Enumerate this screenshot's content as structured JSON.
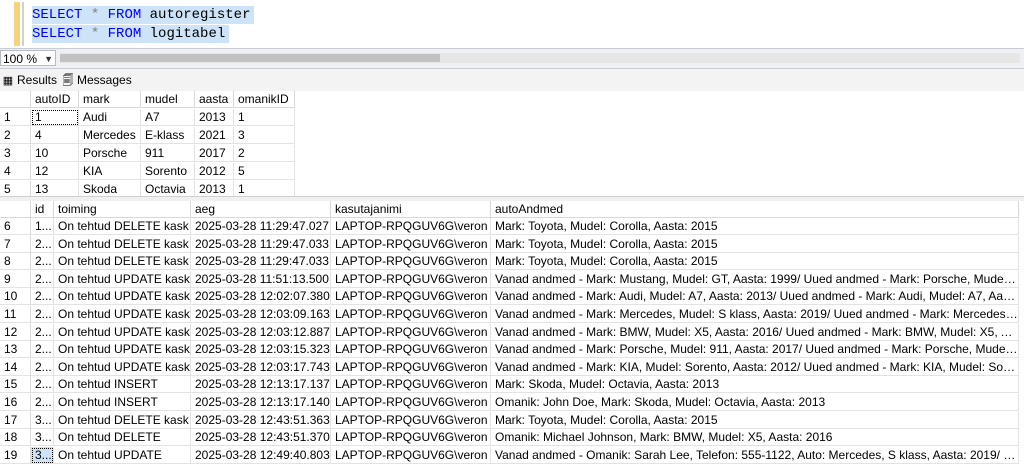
{
  "editor": {
    "lines": [
      {
        "kw1": "SELECT",
        "op": " * ",
        "kw2": "FROM",
        "table": " autoregister"
      },
      {
        "kw1": "SELECT",
        "op": " * ",
        "kw2": "FROM",
        "table": " logitabel"
      }
    ]
  },
  "zoom": {
    "value": "100 %"
  },
  "tabs": {
    "results": "Results",
    "messages": "Messages"
  },
  "grid1": {
    "columns": [
      "autoID",
      "mark",
      "mudel",
      "aasta",
      "omanikID"
    ],
    "rows": [
      {
        "n": "1",
        "c": [
          "1",
          "Audi",
          "A7",
          "2013",
          "1"
        ]
      },
      {
        "n": "2",
        "c": [
          "4",
          "Mercedes",
          "E-klass",
          "2021",
          "3"
        ]
      },
      {
        "n": "3",
        "c": [
          "10",
          "Porsche",
          "911",
          "2017",
          "2"
        ]
      },
      {
        "n": "4",
        "c": [
          "12",
          "KIA",
          "Sorento",
          "2012",
          "5"
        ]
      },
      {
        "n": "5",
        "c": [
          "13",
          "Skoda",
          "Octavia",
          "2013",
          "1"
        ]
      }
    ]
  },
  "grid2": {
    "columns": [
      "id",
      "toiming",
      "aeg",
      "kasutajanimi",
      "autoAndmed"
    ],
    "rows": [
      {
        "n": "6",
        "c": [
          "1...",
          "On tehtud DELETE kask",
          "2025-03-28 11:29:47.027",
          "LAPTOP-RPQGUV6G\\veron",
          "Mark: Toyota, Mudel: Corolla, Aasta: 2015"
        ]
      },
      {
        "n": "7",
        "c": [
          "2...",
          "On tehtud DELETE kask",
          "2025-03-28 11:29:47.033",
          "LAPTOP-RPQGUV6G\\veron",
          "Mark: Toyota, Mudel: Corolla, Aasta: 2015"
        ]
      },
      {
        "n": "8",
        "c": [
          "2...",
          "On tehtud DELETE kask",
          "2025-03-28 11:29:47.033",
          "LAPTOP-RPQGUV6G\\veron",
          "Mark: Toyota, Mudel: Corolla, Aasta: 2015"
        ]
      },
      {
        "n": "9",
        "c": [
          "2...",
          "On tehtud UPDATE kask",
          "2025-03-28 11:51:13.500",
          "LAPTOP-RPQGUV6G\\veron",
          "Vanad andmed - Mark: Mustang, Mudel: GT, Aasta: 1999/ Uued andmed - Mark: Porsche, Mudel: 911, ..."
        ]
      },
      {
        "n": "10",
        "c": [
          "2...",
          "On tehtud UPDATE kask",
          "2025-03-28 12:02:07.380",
          "LAPTOP-RPQGUV6G\\veron",
          "Vanad andmed - Mark: Audi, Mudel: A7, Aasta: 2013/ Uued andmed - Mark: Audi, Mudel: A7, Aasta: 20..."
        ]
      },
      {
        "n": "11",
        "c": [
          "2...",
          "On tehtud UPDATE kask",
          "2025-03-28 12:03:09.163",
          "LAPTOP-RPQGUV6G\\veron",
          "Vanad andmed - Mark: Mercedes, Mudel: S klass, Aasta: 2019/ Uued andmed - Mark: Mercedes, Mudel..."
        ]
      },
      {
        "n": "12",
        "c": [
          "2...",
          "On tehtud UPDATE kask",
          "2025-03-28 12:03:12.887",
          "LAPTOP-RPQGUV6G\\veron",
          "Vanad andmed - Mark: BMW, Mudel: X5, Aasta: 2016/ Uued andmed - Mark: BMW, Mudel: X5, Aasta: 2..."
        ]
      },
      {
        "n": "13",
        "c": [
          "2...",
          "On tehtud UPDATE kask",
          "2025-03-28 12:03:15.323",
          "LAPTOP-RPQGUV6G\\veron",
          "Vanad andmed - Mark: Porsche, Mudel: 911, Aasta: 2017/ Uued andmed - Mark: Porsche, Mudel: 911, ..."
        ]
      },
      {
        "n": "14",
        "c": [
          "2...",
          "On tehtud UPDATE kask",
          "2025-03-28 12:03:17.743",
          "LAPTOP-RPQGUV6G\\veron",
          "Vanad andmed - Mark: KIA, Mudel: Sorento, Aasta: 2012/ Uued andmed - Mark: KIA, Mudel: Sorento, A..."
        ]
      },
      {
        "n": "15",
        "c": [
          "2...",
          "On tehtud INSERT",
          "2025-03-28 12:13:17.137",
          "LAPTOP-RPQGUV6G\\veron",
          "Mark: Skoda, Mudel: Octavia, Aasta: 2013"
        ]
      },
      {
        "n": "16",
        "c": [
          "2...",
          "On tehtud INSERT",
          "2025-03-28 12:13:17.140",
          "LAPTOP-RPQGUV6G\\veron",
          "Omanik: John Doe, Mark: Skoda, Mudel: Octavia, Aasta: 2013"
        ]
      },
      {
        "n": "17",
        "c": [
          "3...",
          "On tehtud DELETE kask",
          "2025-03-28 12:43:51.363",
          "LAPTOP-RPQGUV6G\\veron",
          "Mark: Toyota, Mudel: Corolla, Aasta: 2015"
        ]
      },
      {
        "n": "18",
        "c": [
          "3...",
          "On tehtud DELETE",
          "2025-03-28 12:43:51.370",
          "LAPTOP-RPQGUV6G\\veron",
          "Omanik: Michael Johnson, Mark: BMW, Mudel: X5, Aasta: 2016"
        ]
      },
      {
        "n": "19",
        "c": [
          "3...",
          "On tehtud UPDATE",
          "2025-03-28 12:49:40.803",
          "LAPTOP-RPQGUV6G\\veron",
          "Vanad andmed - Omanik: Sarah Lee, Telefon: 555-1122, Auto: Mercedes, S klass, Aasta: 2019/ Uued ..."
        ]
      }
    ]
  }
}
